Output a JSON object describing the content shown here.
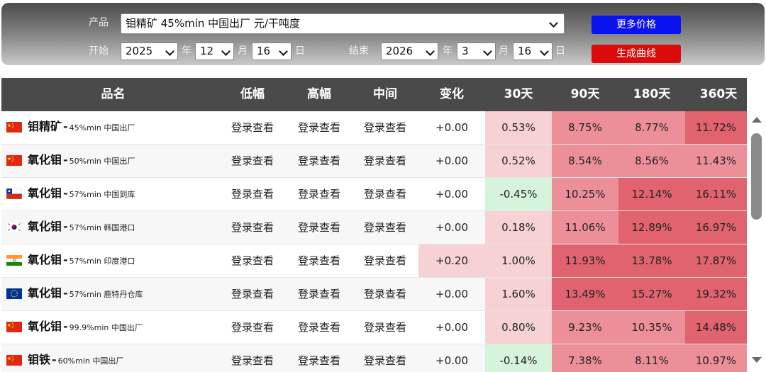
{
  "filters": {
    "product_label": "产品",
    "product_value": "钼精矿 45%min 中国出厂 元/干吨度",
    "start_label": "开始",
    "end_label": "结束",
    "year_unit": "年",
    "month_unit": "月",
    "day_unit": "日",
    "start": {
      "year": "2025",
      "month": "12",
      "day": "16"
    },
    "end": {
      "year": "2026",
      "month": "3",
      "day": "16"
    }
  },
  "buttons": {
    "more_prices": "更多价格",
    "generate_curve": "生成曲线"
  },
  "table": {
    "headers": [
      "品名",
      "低幅",
      "高幅",
      "中间",
      "变化",
      "30天",
      "90天",
      "180天",
      "360天"
    ],
    "rows": [
      {
        "name": "钼精矿",
        "dash": "-",
        "spec": "45%min 中国出厂",
        "flag": "cn",
        "low": "登录查看",
        "high": "登录查看",
        "mid": "登录查看",
        "change": "+0.00",
        "d30": "0.53%",
        "d90": "8.75%",
        "d180": "8.77%",
        "d360": "11.72%"
      },
      {
        "name": "氧化钼",
        "dash": "-",
        "spec": "50%min 中国出厂",
        "flag": "cn",
        "low": "登录查看",
        "high": "登录查看",
        "mid": "登录查看",
        "change": "+0.00",
        "d30": "0.52%",
        "d90": "8.54%",
        "d180": "8.56%",
        "d360": "11.43%"
      },
      {
        "name": "氧化钼",
        "dash": "-",
        "spec": "57%min 中国到库",
        "flag": "cl",
        "low": "登录查看",
        "high": "登录查看",
        "mid": "登录查看",
        "change": "+0.00",
        "d30": "-0.45%",
        "d90": "10.25%",
        "d180": "12.14%",
        "d360": "16.11%"
      },
      {
        "name": "氧化钼",
        "dash": "-",
        "spec": "57%min 韩国港口",
        "flag": "kr",
        "low": "登录查看",
        "high": "登录查看",
        "mid": "登录查看",
        "change": "+0.00",
        "d30": "0.18%",
        "d90": "11.06%",
        "d180": "12.89%",
        "d360": "16.97%"
      },
      {
        "name": "氧化钼",
        "dash": "-",
        "spec": "57%min 印度港口",
        "flag": "in",
        "low": "登录查看",
        "high": "登录查看",
        "mid": "登录查看",
        "change": "+0.20",
        "d30": "1.00%",
        "d90": "11.93%",
        "d180": "13.78%",
        "d360": "17.87%"
      },
      {
        "name": "氧化钼",
        "dash": "-",
        "spec": "57%min 鹿特丹仓库",
        "flag": "eu",
        "low": "登录查看",
        "high": "登录查看",
        "mid": "登录查看",
        "change": "+0.00",
        "d30": "1.60%",
        "d90": "13.49%",
        "d180": "15.27%",
        "d360": "19.32%"
      },
      {
        "name": "氧化钼",
        "dash": "-",
        "spec": "99.9%min 中国出厂",
        "flag": "cn",
        "low": "登录查看",
        "high": "登录查看",
        "mid": "登录查看",
        "change": "+0.00",
        "d30": "0.80%",
        "d90": "9.23%",
        "d180": "10.35%",
        "d360": "14.48%"
      },
      {
        "name": "钼铁",
        "dash": "-",
        "spec": "60%min 中国出厂",
        "flag": "cn",
        "low": "登录查看",
        "high": "登录查看",
        "mid": "登录查看",
        "change": "+0.00",
        "d30": "-0.14%",
        "d90": "7.38%",
        "d180": "8.11%",
        "d360": "10.97%"
      }
    ]
  },
  "colors": {
    "header_bg": "#4a4a4a",
    "btn_blue": "#0a12f2",
    "btn_red": "#dc0b0b",
    "heat_pale": "#f6d2d4",
    "heat_mid": "#ec8f99",
    "heat_strong": "#e0636f",
    "heat_negative": "#d6f3dc"
  }
}
